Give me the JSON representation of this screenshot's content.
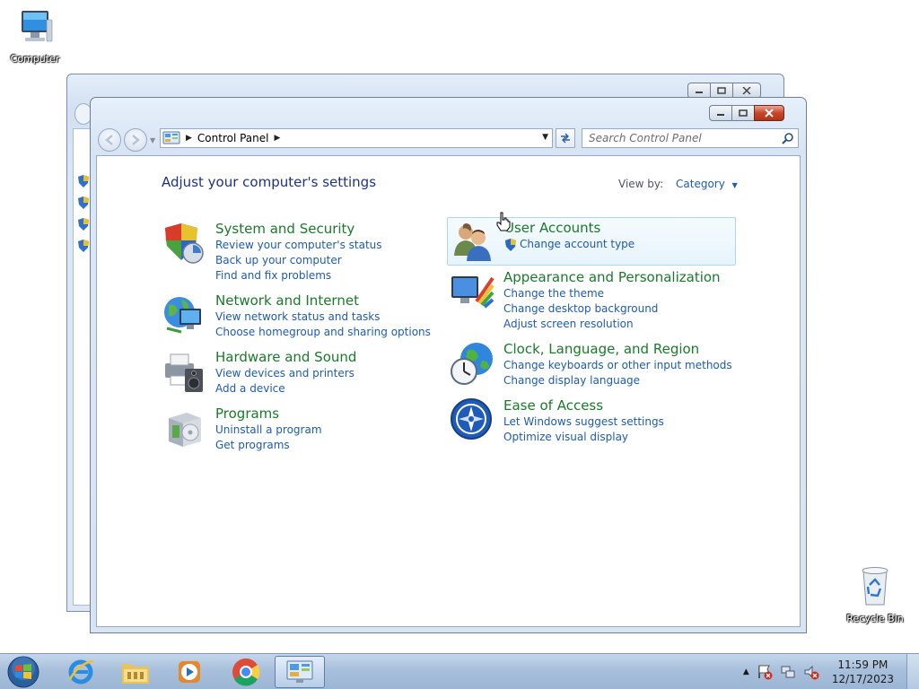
{
  "desktop": {
    "computer_label": "Computer",
    "recycle_label": "Recycle Bin"
  },
  "window": {
    "breadcrumb": "Control Panel",
    "search_placeholder": "Search Control Panel",
    "heading": "Adjust your computer's settings",
    "view_by_label": "View by:",
    "view_by_value": "Category"
  },
  "categories_left": [
    {
      "title": "System and Security",
      "icon": "shield-icon",
      "links": [
        "Review your computer's status",
        "Back up your computer",
        "Find and fix problems"
      ]
    },
    {
      "title": "Network and Internet",
      "icon": "network-globe-icon",
      "links": [
        "View network status and tasks",
        "Choose homegroup and sharing options"
      ]
    },
    {
      "title": "Hardware and Sound",
      "icon": "printer-speaker-icon",
      "links": [
        "View devices and printers",
        "Add a device"
      ]
    },
    {
      "title": "Programs",
      "icon": "programs-box-icon",
      "links": [
        "Uninstall a program",
        "Get programs"
      ]
    }
  ],
  "categories_right": [
    {
      "title": "User Accounts",
      "icon": "users-icon",
      "links": [
        "Change account type"
      ]
    },
    {
      "title": "Appearance and Personalization",
      "icon": "monitor-palette-icon",
      "links": [
        "Change the theme",
        "Change desktop background",
        "Adjust screen resolution"
      ]
    },
    {
      "title": "Clock, Language, and Region",
      "icon": "clock-globe-icon",
      "links": [
        "Change keyboards or other input methods",
        "Change display language"
      ]
    },
    {
      "title": "Ease of Access",
      "icon": "ease-of-access-icon",
      "links": [
        "Let Windows suggest settings",
        "Optimize visual display"
      ]
    }
  ],
  "taskbar": {
    "apps": [
      "Internet Explorer",
      "Windows Explorer",
      "Windows Media Player",
      "Google Chrome",
      "Control Panel"
    ],
    "time": "11:59 PM",
    "date": "12/17/2023"
  }
}
